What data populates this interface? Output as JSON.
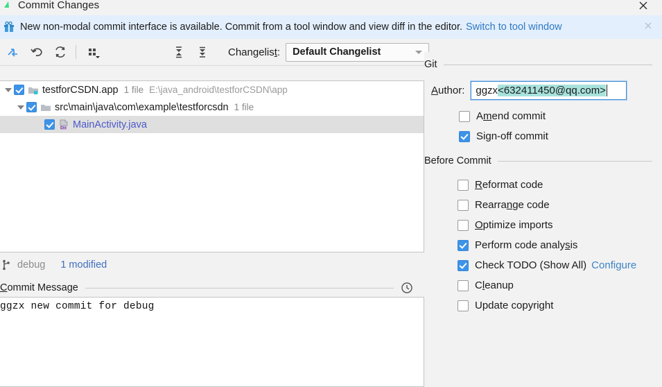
{
  "window": {
    "title": "Commit Changes",
    "app_icon": "android-studio-icon",
    "close_label": "✕"
  },
  "notification": {
    "icon": "gift-icon",
    "message": "New non-modal commit interface is available. Commit from a tool window and view diff in the editor.",
    "link": "Switch to tool window",
    "close_label": "✕"
  },
  "toolbar": {
    "buttons": [
      {
        "name": "show-diff-icon",
        "label": "Show Diff"
      },
      {
        "name": "rollback-icon",
        "label": "Rollback"
      },
      {
        "name": "refresh-icon",
        "label": "Refresh Changes"
      },
      {
        "name": "group-by-icon",
        "label": "Group By"
      },
      {
        "name": "expand-all-icon",
        "label": "Expand All"
      },
      {
        "name": "collapse-all-icon",
        "label": "Collapse All"
      }
    ],
    "changelist_label": "Changelist:",
    "changelist_mnemonic": "t",
    "changelist_value": "Default Changelist"
  },
  "tree": {
    "rows": [
      {
        "indent": 0,
        "twisty": true,
        "checked": true,
        "icon": "module-folder-icon",
        "label": "testforCSDN.app",
        "meta": "1 file",
        "path": "E:\\java_android\\testforCSDN\\app",
        "selected": false,
        "link": false
      },
      {
        "indent": 1,
        "twisty": true,
        "checked": true,
        "icon": "folder-icon",
        "label": "src\\main\\java\\com\\example\\testforcsdn",
        "meta": "1 file",
        "path": "",
        "selected": false,
        "link": false
      },
      {
        "indent": 2,
        "twisty": false,
        "checked": true,
        "icon": "java-class-icon",
        "label": "MainActivity.java",
        "meta": "",
        "path": "",
        "selected": true,
        "link": true
      }
    ]
  },
  "status": {
    "branch_icon": "git-branch-icon",
    "branch": "debug",
    "modified": "1 modified"
  },
  "commit_message": {
    "title": "Commit Message",
    "title_mnemonic": "C",
    "history_icon": "clock-icon",
    "value": "ggzx new commit for debug"
  },
  "git_section": {
    "title": "Git",
    "author_label": "Author:",
    "author_mnemonic": "A",
    "author_value_plain": "ggzx ",
    "author_value_selected": "<632411450@qq.com>",
    "options": [
      {
        "label": "Amend commit",
        "mnemonic": "m",
        "checked": false,
        "name": "amend-commit-checkbox"
      },
      {
        "label": "Sign-off commit",
        "mnemonic": "g",
        "checked": true,
        "name": "sign-off-commit-checkbox"
      }
    ]
  },
  "before_commit": {
    "title": "Before Commit",
    "options": [
      {
        "label": "Reformat code",
        "mnemonic": "R",
        "checked": false,
        "name": "reformat-code-checkbox",
        "link": ""
      },
      {
        "label": "Rearrange code",
        "mnemonic": "n",
        "checked": false,
        "name": "rearrange-code-checkbox",
        "link": ""
      },
      {
        "label": "Optimize imports",
        "mnemonic": "O",
        "checked": false,
        "name": "optimize-imports-checkbox",
        "link": ""
      },
      {
        "label": "Perform code analysis",
        "mnemonic": "s",
        "checked": true,
        "name": "perform-code-analysis-checkbox",
        "link": ""
      },
      {
        "label": "Check TODO (Show All)",
        "mnemonic": "",
        "checked": true,
        "name": "check-todo-checkbox",
        "link": "Configure"
      },
      {
        "label": "Cleanup",
        "mnemonic": "l",
        "checked": false,
        "name": "cleanup-checkbox",
        "link": ""
      },
      {
        "label": "Update copyright",
        "mnemonic": "",
        "checked": false,
        "name": "update-copyright-checkbox",
        "link": ""
      }
    ]
  },
  "colors": {
    "accent_blue": "#3d93e8",
    "link_blue": "#3d84c6",
    "selection_teal": "#a8e2dc",
    "notif_bg": "#e3effc",
    "panel_bg": "#f2f2f2",
    "file_link": "#4b58c8"
  }
}
